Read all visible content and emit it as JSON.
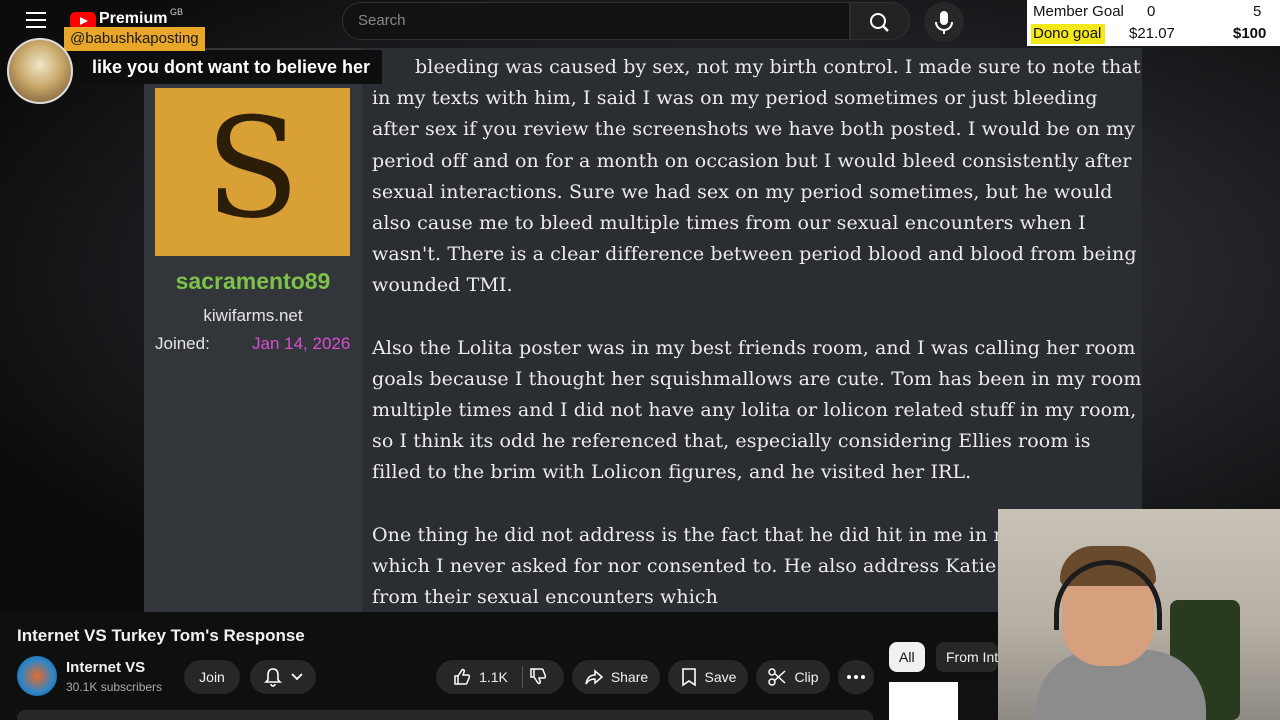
{
  "topbar": {
    "logo_text": "Premium",
    "region": "GB",
    "search_placeholder": "Search"
  },
  "goal_widget": {
    "row1": {
      "label": "Member Goal",
      "current": "0",
      "target": "5"
    },
    "row2": {
      "label": "Dono goal",
      "current": "$21.07",
      "target": "$100"
    },
    "highlight_color": "#f2e81a"
  },
  "chat": {
    "username": "@babushkaposting",
    "message": "like you dont want to believe her"
  },
  "forum_post": {
    "avatar_letter": "S",
    "avatar_color": "#d9a035",
    "username": "sacramento89",
    "site": "kiwifarms.net",
    "joined_label": "Joined:",
    "joined_date": "Jan 14, 2026",
    "paragraphs": [
      "bleeding was caused by sex, not my birth control. I made sure to note that in my texts with him, I said I was on my period sometimes or just bleeding after sex if you review the screenshots we have both posted. I would be on my period off and on for a month on occasion but I would bleed consistently after sexual interactions. Sure we had sex on my period sometimes, but he would also cause me to bleed multiple times from our sexual encounters when I wasn't. There is a clear difference between period blood and blood from being wounded TMI.",
      "Also the Lolita poster was in my best friends room, and I was calling her room goals because I thought her squishmallows are cute. Tom has been in my room multiple times and I did not have any lolita or lolicon related stuff in my room, so I think its odd he referenced that, especially considering Ellies room is filled to the brim with Lolicon figures, and he visited her IRL.",
      "One thing he did not address is the fact that he did hit in me in multiple times which I never asked for nor consented to. He also address Katie being bruised from their sexual encounters which"
    ]
  },
  "video": {
    "title": "Internet VS Turkey Tom's Response",
    "channel_name": "Internet VS",
    "subscribers": "30.1K subscribers",
    "join_label": "Join",
    "like_count": "1.1K",
    "share_label": "Share",
    "save_label": "Save",
    "clip_label": "Clip"
  },
  "sidebar_chips": {
    "all": "All",
    "from": "From Internet VS"
  }
}
